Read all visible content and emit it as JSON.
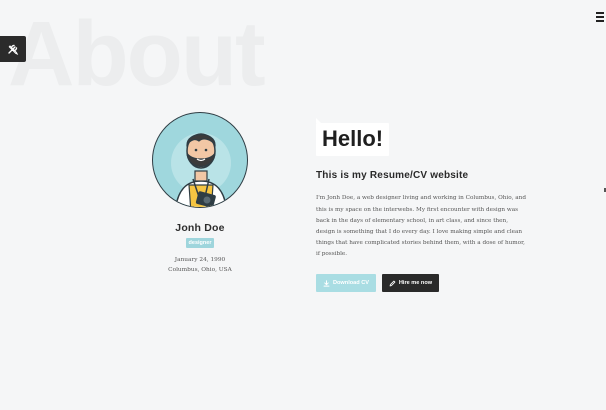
{
  "section": {
    "background_title": "About"
  },
  "profile": {
    "name": "Jonh Doe",
    "role": "designer",
    "birthdate": "January 24, 1990",
    "location": "Columbus, Ohio, USA"
  },
  "content": {
    "greeting": "Hello!",
    "subtitle": "This is my Resume/CV website",
    "bio": "I'm Jonh Doe, a web designer living and working in Columbus, Ohio, and this is my space on the interwebs. My first encounter with design was back in the days of elementary school, in art class, and since then, design is something that I do every day. I love making simple and clean things that have complicated stories behind them, with a dose of humor, if possible."
  },
  "buttons": {
    "download_label": "Download CV",
    "hire_label": "Hire me now"
  },
  "icons": {
    "tools": "wrench-pencil-icon",
    "menu": "hamburger-icon",
    "download": "download-icon",
    "hire": "pencil-icon"
  },
  "colors": {
    "accent": "#9ed5dc",
    "dark": "#2a2a2a",
    "background": "#f5f6f7"
  }
}
